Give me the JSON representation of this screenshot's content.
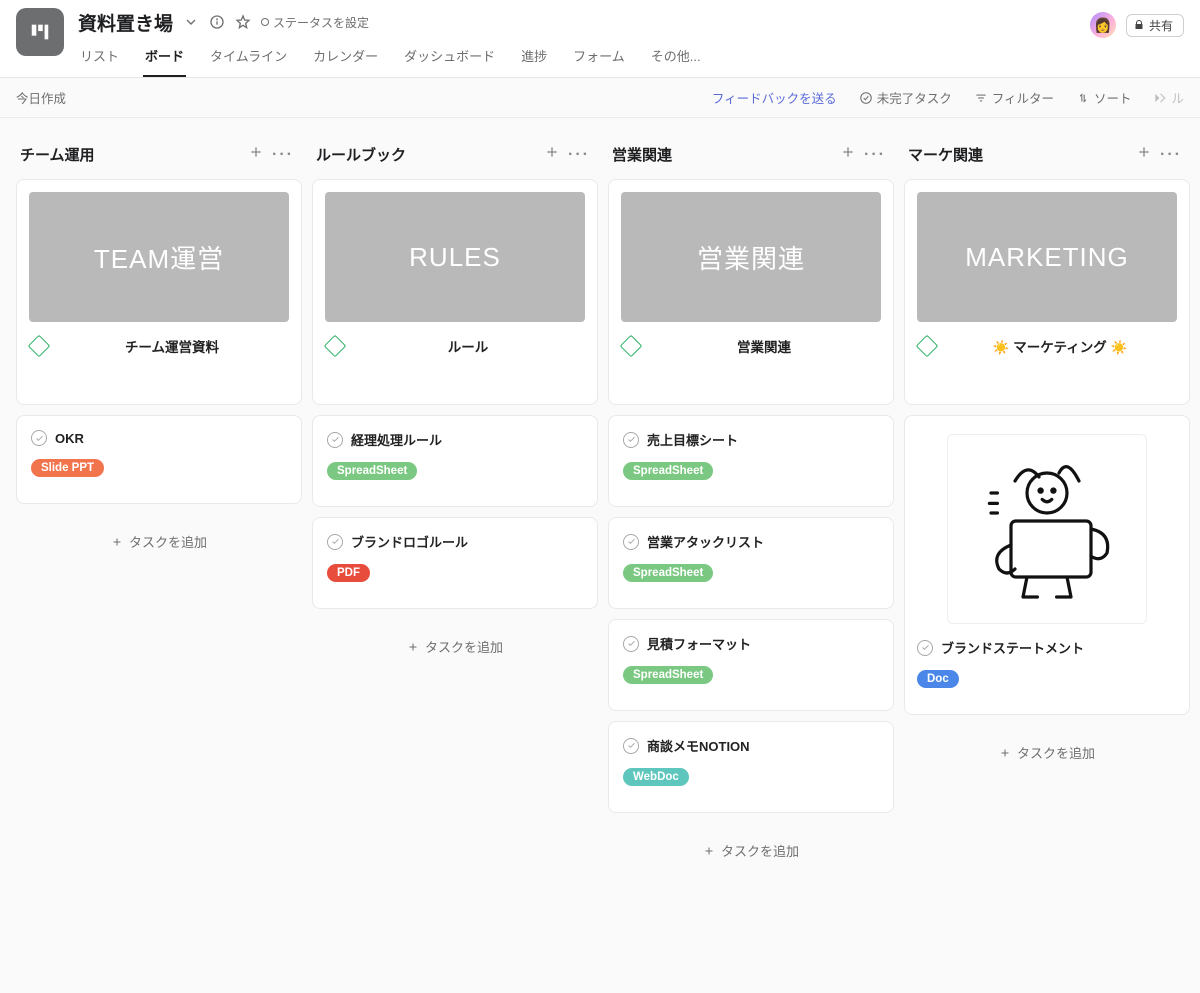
{
  "project": {
    "title": "資料置き場",
    "status_label": "ステータスを設定"
  },
  "tabs": [
    {
      "label": "リスト"
    },
    {
      "label": "ボード",
      "active": true
    },
    {
      "label": "タイムライン"
    },
    {
      "label": "カレンダー"
    },
    {
      "label": "ダッシュボード"
    },
    {
      "label": "進捗"
    },
    {
      "label": "フォーム"
    },
    {
      "label": "その他..."
    }
  ],
  "share_label": "共有",
  "toolbar": {
    "left": "今日作成",
    "feedback": "フィードバックを送る",
    "incomplete": "未完了タスク",
    "filter": "フィルター",
    "sort": "ソート",
    "rule_cut": "ル"
  },
  "add_task_label": "タスクを追加",
  "columns": [
    {
      "title": "チーム運用",
      "cover": {
        "label": "TEAM運営",
        "subtitle": "チーム運営資料"
      },
      "tasks": [
        {
          "title": "OKR",
          "chip": {
            "label": "Slide PPT",
            "cls": "orange"
          }
        }
      ]
    },
    {
      "title": "ルールブック",
      "cover": {
        "label": "RULES",
        "subtitle": "ルール"
      },
      "tasks": [
        {
          "title": "経理処理ルール",
          "chip": {
            "label": "SpreadSheet",
            "cls": "green"
          }
        },
        {
          "title": "ブランドロゴルール",
          "chip": {
            "label": "PDF",
            "cls": "red"
          }
        }
      ]
    },
    {
      "title": "営業関連",
      "cover": {
        "label": "営業関連",
        "subtitle": "営業関連"
      },
      "tasks": [
        {
          "title": "売上目標シート",
          "chip": {
            "label": "SpreadSheet",
            "cls": "green"
          }
        },
        {
          "title": "営業アタックリスト",
          "chip": {
            "label": "SpreadSheet",
            "cls": "green"
          }
        },
        {
          "title": "見積フォーマット",
          "chip": {
            "label": "SpreadSheet",
            "cls": "green"
          }
        },
        {
          "title": "商談メモNOTION",
          "chip": {
            "label": "WebDoc",
            "cls": "teal"
          }
        }
      ]
    },
    {
      "title": "マーケ関連",
      "cover": {
        "label": "MARKETING",
        "subtitle": "☀️ マーケティング ☀️"
      },
      "image_card": {
        "title": "ブランドステートメント",
        "chip": {
          "label": "Doc",
          "cls": "blue"
        }
      }
    }
  ]
}
